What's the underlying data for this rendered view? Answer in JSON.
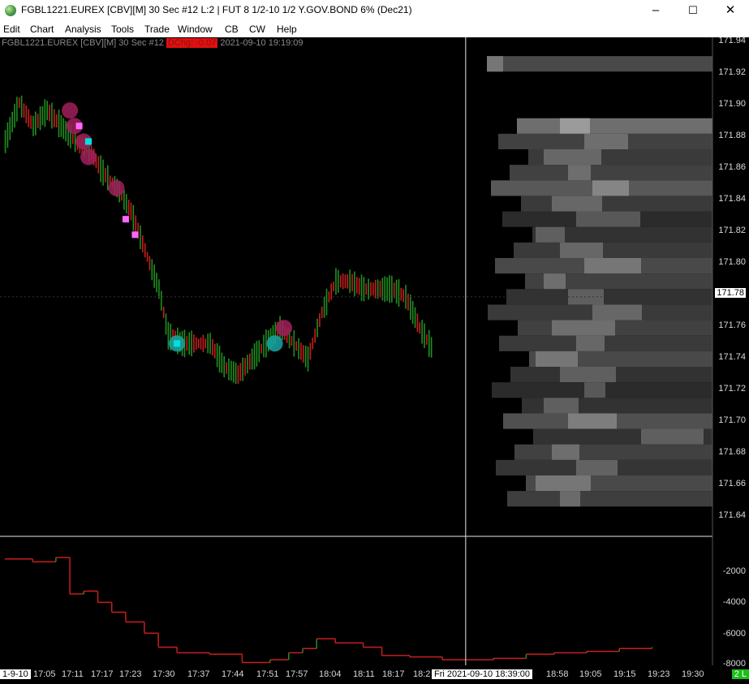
{
  "window": {
    "title": "FGBL1221.EUREX [CBV][M]  30 Sec   #12 L:2 | FUT 8 1/2-10 1/2 Y.GOV.BOND 6% (Dec21)",
    "minimize": "–",
    "maximize": "☐",
    "close": "✕"
  },
  "menu": [
    "Edit",
    "Chart",
    "Analysis",
    "Tools",
    "Trade",
    "Window",
    "CB",
    "CW",
    "Help"
  ],
  "chart_info": {
    "prefix": "FGBL1221.EUREX [CBV][M]  30 Sec   #12",
    "change": "DChg: -0.07",
    "timestamp": "2021-09-10 19:19:09"
  },
  "price_axis": [
    "171.94",
    "171.92",
    "171.90",
    "171.88",
    "171.86",
    "171.84",
    "171.82",
    "171.80",
    "171.78",
    "171.76",
    "171.74",
    "171.72",
    "171.70",
    "171.68",
    "171.66",
    "171.64"
  ],
  "current_price": "171.78",
  "indicator_axis": [
    "-2000",
    "-4000",
    "-6000",
    "-8000"
  ],
  "time_axis": [
    "1-9-10",
    "17:05",
    "17:11",
    "17:17",
    "17:23",
    "17:30",
    "17:37",
    "17:44",
    "17:51",
    "17:57",
    "18:04",
    "18:11",
    "18:17",
    "18:2",
    "18:58",
    "19:05",
    "19:15",
    "19:23",
    "19:30"
  ],
  "cursor_time": "Fri 2021-09-10  18:39:00",
  "status_badge": "2 L",
  "colors": {
    "up": "#1f8f1f",
    "down": "#c81e1e",
    "marker_magenta": "#ff66ff",
    "marker_cyan": "#00e0e0",
    "crosshair": "#e8e8e8",
    "change_badge": "#e01010"
  },
  "chart_data": {
    "type": "line",
    "price_range": [
      171.63,
      171.945
    ],
    "current_price": 171.78,
    "price_series": [
      [
        "17:00",
        171.88
      ],
      [
        "17:03",
        171.905
      ],
      [
        "17:06",
        171.89
      ],
      [
        "17:09",
        171.9
      ],
      [
        "17:12",
        171.89
      ],
      [
        "17:15",
        171.88
      ],
      [
        "17:18",
        171.875
      ],
      [
        "17:21",
        171.86
      ],
      [
        "17:24",
        171.85
      ],
      [
        "17:27",
        171.835
      ],
      [
        "17:30",
        171.81
      ],
      [
        "17:33",
        171.785
      ],
      [
        "17:35",
        171.755
      ],
      [
        "17:38",
        171.75
      ],
      [
        "17:41",
        171.75
      ],
      [
        "17:44",
        171.75
      ],
      [
        "17:47",
        171.735
      ],
      [
        "17:50",
        171.73
      ],
      [
        "17:53",
        171.74
      ],
      [
        "17:56",
        171.75
      ],
      [
        "17:59",
        171.76
      ],
      [
        "18:02",
        171.75
      ],
      [
        "18:05",
        171.74
      ],
      [
        "18:08",
        171.77
      ],
      [
        "18:11",
        171.79
      ],
      [
        "18:14",
        171.79
      ],
      [
        "18:17",
        171.785
      ],
      [
        "18:20",
        171.785
      ],
      [
        "18:23",
        171.785
      ],
      [
        "18:26",
        171.78
      ],
      [
        "18:29",
        171.76
      ],
      [
        "18:32",
        171.745
      ]
    ],
    "indicator_range": [
      -8100,
      1000
    ],
    "indicator_series": [
      [
        "17:00",
        -500
      ],
      [
        "17:06",
        -700
      ],
      [
        "17:11",
        -400
      ],
      [
        "17:14",
        -3000
      ],
      [
        "17:17",
        -2800
      ],
      [
        "17:20",
        -3600
      ],
      [
        "17:23",
        -4300
      ],
      [
        "17:26",
        -5000
      ],
      [
        "17:30",
        -5800
      ],
      [
        "17:33",
        -6800
      ],
      [
        "17:37",
        -7200
      ],
      [
        "17:44",
        -7300
      ],
      [
        "17:51",
        -7900
      ],
      [
        "17:57",
        -7700
      ],
      [
        "18:01",
        -7200
      ],
      [
        "18:04",
        -6900
      ],
      [
        "18:07",
        -6200
      ],
      [
        "18:11",
        -6500
      ],
      [
        "18:17",
        -6800
      ],
      [
        "18:21",
        -7400
      ],
      [
        "18:27",
        -7500
      ],
      [
        "18:34",
        -7700
      ],
      [
        "18:39",
        -7700
      ],
      [
        "18:45",
        -7600
      ],
      [
        "18:52",
        -7300
      ],
      [
        "18:58",
        -7200
      ],
      [
        "19:05",
        -7100
      ],
      [
        "19:12",
        -6900
      ],
      [
        "19:19",
        -6800
      ]
    ],
    "magenta_markers": [
      [
        "17:16",
        171.89
      ],
      [
        "17:18",
        171.88
      ],
      [
        "17:26",
        171.83
      ],
      [
        "17:28",
        171.82
      ]
    ],
    "cyan_markers": [
      [
        "17:37",
        171.75
      ],
      [
        "17:18",
        171.88
      ]
    ],
    "bubbles": [
      {
        "time": "17:14",
        "price": 171.9,
        "color": "magenta"
      },
      {
        "time": "17:15",
        "price": 171.89,
        "color": "magenta"
      },
      {
        "time": "17:17",
        "price": 171.88,
        "color": "magenta"
      },
      {
        "time": "17:18",
        "price": 171.87,
        "color": "magenta"
      },
      {
        "time": "17:24",
        "price": 171.85,
        "color": "magenta"
      },
      {
        "time": "17:37",
        "price": 171.75,
        "color": "cyan"
      },
      {
        "time": "17:58",
        "price": 171.75,
        "color": "cyan"
      },
      {
        "time": "18:00",
        "price": 171.76,
        "color": "magenta"
      }
    ],
    "heatmap_rows": [
      {
        "price": 171.93,
        "intensity": 0.35
      },
      {
        "price": 171.89,
        "intensity": 0.6
      },
      {
        "price": 171.88,
        "intensity": 0.3
      },
      {
        "price": 171.87,
        "intensity": 0.25
      },
      {
        "price": 171.86,
        "intensity": 0.3
      },
      {
        "price": 171.85,
        "intensity": 0.45
      },
      {
        "price": 171.84,
        "intensity": 0.25
      },
      {
        "price": 171.83,
        "intensity": 0.15
      },
      {
        "price": 171.82,
        "intensity": 0.2
      },
      {
        "price": 171.81,
        "intensity": 0.25
      },
      {
        "price": 171.8,
        "intensity": 0.35
      },
      {
        "price": 171.79,
        "intensity": 0.3
      },
      {
        "price": 171.78,
        "intensity": 0.2
      },
      {
        "price": 171.77,
        "intensity": 0.25
      },
      {
        "price": 171.76,
        "intensity": 0.3
      },
      {
        "price": 171.75,
        "intensity": 0.25
      },
      {
        "price": 171.74,
        "intensity": 0.35
      },
      {
        "price": 171.73,
        "intensity": 0.2
      },
      {
        "price": 171.72,
        "intensity": 0.15
      },
      {
        "price": 171.71,
        "intensity": 0.2
      },
      {
        "price": 171.7,
        "intensity": 0.4
      },
      {
        "price": 171.69,
        "intensity": 0.2
      },
      {
        "price": 171.68,
        "intensity": 0.3
      },
      {
        "price": 171.67,
        "intensity": 0.22
      },
      {
        "price": 171.66,
        "intensity": 0.35
      },
      {
        "price": 171.65,
        "intensity": 0.28
      }
    ],
    "crosshair_time": "18:39"
  }
}
